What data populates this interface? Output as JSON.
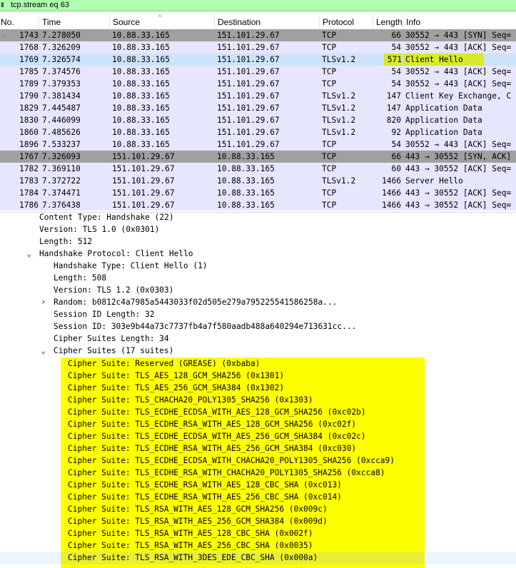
{
  "filter": {
    "text": "tcp.stream eq 63"
  },
  "columns": [
    "No.",
    "Time",
    "Source",
    "Destination",
    "Protocol",
    "Length",
    "Info"
  ],
  "packets": [
    {
      "no": "1743",
      "time": "7.278050",
      "src": "10.88.33.165",
      "dst": "151.101.29.67",
      "proto": "TCP",
      "len": "66",
      "info": "30552 → 443 [SYN] Seq=",
      "style": "syn"
    },
    {
      "no": "1768",
      "time": "7.326209",
      "src": "10.88.33.165",
      "dst": "151.101.29.67",
      "proto": "TCP",
      "len": "54",
      "info": "30552 → 443 [ACK] Seq=",
      "style": "normal"
    },
    {
      "no": "1769",
      "time": "7.326574",
      "src": "10.88.33.165",
      "dst": "151.101.29.67",
      "proto": "TLSv1.2",
      "len": "571",
      "info": "Client Hello",
      "style": "selected"
    },
    {
      "no": "1785",
      "time": "7.374576",
      "src": "10.88.33.165",
      "dst": "151.101.29.67",
      "proto": "TCP",
      "len": "54",
      "info": "30552 → 443 [ACK] Seq=",
      "style": "normal"
    },
    {
      "no": "1789",
      "time": "7.379353",
      "src": "10.88.33.165",
      "dst": "151.101.29.67",
      "proto": "TCP",
      "len": "54",
      "info": "30552 → 443 [ACK] Seq=",
      "style": "normal"
    },
    {
      "no": "1790",
      "time": "7.381434",
      "src": "10.88.33.165",
      "dst": "151.101.29.67",
      "proto": "TLSv1.2",
      "len": "147",
      "info": "Client Key Exchange, C",
      "style": "normal"
    },
    {
      "no": "1829",
      "time": "7.445487",
      "src": "10.88.33.165",
      "dst": "151.101.29.67",
      "proto": "TLSv1.2",
      "len": "147",
      "info": "Application Data",
      "style": "normal"
    },
    {
      "no": "1830",
      "time": "7.446099",
      "src": "10.88.33.165",
      "dst": "151.101.29.67",
      "proto": "TLSv1.2",
      "len": "820",
      "info": "Application Data",
      "style": "normal"
    },
    {
      "no": "1860",
      "time": "7.485626",
      "src": "10.88.33.165",
      "dst": "151.101.29.67",
      "proto": "TLSv1.2",
      "len": "92",
      "info": "Application Data",
      "style": "normal"
    },
    {
      "no": "1896",
      "time": "7.533237",
      "src": "10.88.33.165",
      "dst": "151.101.29.67",
      "proto": "TCP",
      "len": "54",
      "info": "30552 → 443 [ACK] Seq=",
      "style": "normal"
    },
    {
      "no": "1767",
      "time": "7.326093",
      "src": "151.101.29.67",
      "dst": "10.88.33.165",
      "proto": "TCP",
      "len": "66",
      "info": "443 → 30552 [SYN, ACK]",
      "style": "syn"
    },
    {
      "no": "1782",
      "time": "7.369110",
      "src": "151.101.29.67",
      "dst": "10.88.33.165",
      "proto": "TCP",
      "len": "60",
      "info": "443 → 30552 [ACK] Seq=",
      "style": "normal"
    },
    {
      "no": "1783",
      "time": "7.372722",
      "src": "151.101.29.67",
      "dst": "10.88.33.165",
      "proto": "TLSv1.2",
      "len": "1466",
      "info": "Server Hello",
      "style": "normal"
    },
    {
      "no": "1784",
      "time": "7.374471",
      "src": "151.101.29.67",
      "dst": "10.88.33.165",
      "proto": "TCP",
      "len": "1466",
      "info": "443 → 30552 [ACK] Seq=",
      "style": "normal"
    },
    {
      "no": "1786",
      "time": "7.376438",
      "src": "151.101.29.67",
      "dst": "10.88.33.165",
      "proto": "TCP",
      "len": "1466",
      "info": "443 → 30552 [ACK] Seq=",
      "style": "normal"
    }
  ],
  "details": [
    {
      "indent": 0,
      "arrow": "",
      "text": "Content Type: Handshake (22)"
    },
    {
      "indent": 0,
      "arrow": "",
      "text": "Version: TLS 1.0 (0x0301)"
    },
    {
      "indent": 0,
      "arrow": "",
      "text": "Length: 512"
    },
    {
      "indent": 0,
      "arrow": "open",
      "text": "Handshake Protocol: Client Hello"
    },
    {
      "indent": 1,
      "arrow": "",
      "text": "Handshake Type: Client Hello (1)"
    },
    {
      "indent": 1,
      "arrow": "",
      "text": "Length: 508"
    },
    {
      "indent": 1,
      "arrow": "",
      "text": "Version: TLS 1.2 (0x0303)"
    },
    {
      "indent": 1,
      "arrow": "closed",
      "text": "Random: b0812c4a7985a5443033f02d505e279a795225541586258a..."
    },
    {
      "indent": 1,
      "arrow": "",
      "text": "Session ID Length: 32"
    },
    {
      "indent": 1,
      "arrow": "",
      "text": "Session ID: 303e9b44a73c7737fb4a7f580aadb488a640294e713631cc..."
    },
    {
      "indent": 1,
      "arrow": "",
      "text": "Cipher Suites Length: 34"
    },
    {
      "indent": 1,
      "arrow": "open",
      "text": "Cipher Suites (17 suites)"
    },
    {
      "indent": 2,
      "arrow": "",
      "text": "Cipher Suite: Reserved (GREASE) (0xbaba)"
    },
    {
      "indent": 2,
      "arrow": "",
      "text": "Cipher Suite: TLS_AES_128_GCM_SHA256 (0x1301)"
    },
    {
      "indent": 2,
      "arrow": "",
      "text": "Cipher Suite: TLS_AES_256_GCM_SHA384 (0x1302)"
    },
    {
      "indent": 2,
      "arrow": "",
      "text": "Cipher Suite: TLS_CHACHA20_POLY1305_SHA256 (0x1303)"
    },
    {
      "indent": 2,
      "arrow": "",
      "text": "Cipher Suite: TLS_ECDHE_ECDSA_WITH_AES_128_GCM_SHA256 (0xc02b)"
    },
    {
      "indent": 2,
      "arrow": "",
      "text": "Cipher Suite: TLS_ECDHE_RSA_WITH_AES_128_GCM_SHA256 (0xc02f)"
    },
    {
      "indent": 2,
      "arrow": "",
      "text": "Cipher Suite: TLS_ECDHE_ECDSA_WITH_AES_256_GCM_SHA384 (0xc02c)"
    },
    {
      "indent": 2,
      "arrow": "",
      "text": "Cipher Suite: TLS_ECDHE_RSA_WITH_AES_256_GCM_SHA384 (0xc030)"
    },
    {
      "indent": 2,
      "arrow": "",
      "text": "Cipher Suite: TLS_ECDHE_ECDSA_WITH_CHACHA20_POLY1305_SHA256 (0xcca9)"
    },
    {
      "indent": 2,
      "arrow": "",
      "text": "Cipher Suite: TLS_ECDHE_RSA_WITH_CHACHA20_POLY1305_SHA256 (0xcca8)"
    },
    {
      "indent": 2,
      "arrow": "",
      "text": "Cipher Suite: TLS_ECDHE_RSA_WITH_AES_128_CBC_SHA (0xc013)"
    },
    {
      "indent": 2,
      "arrow": "",
      "text": "Cipher Suite: TLS_ECDHE_RSA_WITH_AES_256_CBC_SHA (0xc014)"
    },
    {
      "indent": 2,
      "arrow": "",
      "text": "Cipher Suite: TLS_RSA_WITH_AES_128_GCM_SHA256 (0x009c)"
    },
    {
      "indent": 2,
      "arrow": "",
      "text": "Cipher Suite: TLS_RSA_WITH_AES_256_GCM_SHA384 (0x009d)"
    },
    {
      "indent": 2,
      "arrow": "",
      "text": "Cipher Suite: TLS_RSA_WITH_AES_128_CBC_SHA (0x002f)"
    },
    {
      "indent": 2,
      "arrow": "",
      "text": "Cipher Suite: TLS_RSA_WITH_AES_256_CBC_SHA (0x0035)"
    },
    {
      "indent": 2,
      "arrow": "",
      "text": "Cipher Suite: TLS_RSA_WITH_3DES_EDE_CBC_SHA (0x000a)"
    }
  ],
  "colors": {
    "filter_bg": "#afffaf",
    "row_normal": "#e7e6ff",
    "row_syn": "#a0a0a0",
    "row_selected": "#cce3fb",
    "highlight_yellow": "#ffff00"
  }
}
